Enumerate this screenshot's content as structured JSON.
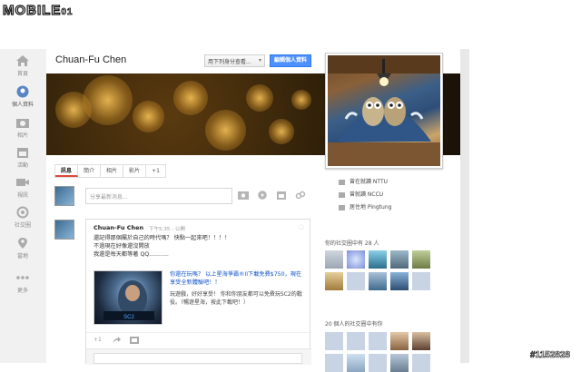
{
  "watermark": {
    "logo_main": "MOBILE",
    "logo_tail": "01",
    "id": "#1152828"
  },
  "nav": [
    {
      "label": "首頁",
      "icon": "home-icon"
    },
    {
      "label": "個人資料",
      "icon": "profile-icon",
      "active": true
    },
    {
      "label": "相片",
      "icon": "camera-icon"
    },
    {
      "label": "活動",
      "icon": "calendar-icon"
    },
    {
      "label": "視訊",
      "icon": "hangout-icon"
    },
    {
      "label": "社交圈",
      "icon": "circles-icon"
    },
    {
      "label": "當地",
      "icon": "location-pin-icon"
    },
    {
      "label": "更多",
      "icon": "more-dots-icon"
    }
  ],
  "profile": {
    "name": "Chuan-Fu Chen",
    "view_as": "用下列身分查看...",
    "edit_button": "編輯個人資料"
  },
  "tabs": [
    "訊息",
    "簡介",
    "相片",
    "影片",
    "+1"
  ],
  "share": {
    "placeholder": "分享最新消息..."
  },
  "post": {
    "author": "Chuan-Fu Chen",
    "meta": "下午5:35 - 公開",
    "lines": [
      "還記得那個屬於自己的時代嗎？ 快點一起來吧！！！！",
      "不過現在好像還沒開放",
      "我還是每天都等著 QQ..........."
    ],
    "link_title": "你還在玩嗎？ 以上星海爭霸®II下載免費$750，現在享受全新體驗吧！！",
    "link_desc": "玩遊戲，好好享受！ 你和你朋友都可以免費玩SC2的戰役。（暢遊星海，按此下載吧！）",
    "plus_one": "+1"
  },
  "info": [
    {
      "icon": "school-icon",
      "text": "曾在就讀 NTTU"
    },
    {
      "icon": "school-icon",
      "text": "曾就讀 NCCU"
    },
    {
      "icon": "home-pin-icon",
      "text": "居住地 Pingtung"
    }
  ],
  "circles": {
    "in_title": "你的社交圈中有 28 人",
    "has_you_title": "20 個人的社交圈中有你"
  }
}
